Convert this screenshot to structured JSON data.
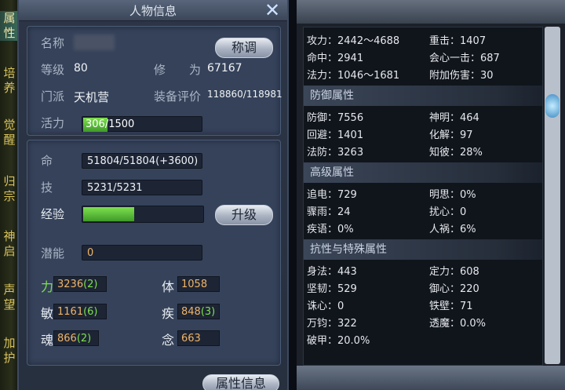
{
  "side_tabs": [
    "属性",
    "培养",
    "觉醒",
    "归宗",
    "神启",
    "声望",
    "加护"
  ],
  "panel": {
    "title": "人物信息",
    "name_label": "名称",
    "name_value": "...",
    "title_button": "称调",
    "level_label": "等级",
    "level_value": "80",
    "cultivation_label": "修　　为",
    "cultivation_value": "67167",
    "faction_label": "门派",
    "faction_value": "天机营",
    "gear_label": "装备评价",
    "gear_value": "118860/118981",
    "vitality_label": "活力",
    "vitality_current": "306",
    "vitality_text": "/1500",
    "vitality_fraction": 0.204
  },
  "stats": {
    "hp_label": "命",
    "hp_value": "51804/51804(+3600)",
    "skill_label": "技",
    "skill_value": "5231/5231",
    "exp_label": "经验",
    "exp_fraction": 0.43,
    "upgrade_button": "升级",
    "potential_label": "潜能",
    "potential_value": "0",
    "attrs": [
      {
        "label": "力",
        "value": "3236",
        "bonus": "(2)"
      },
      {
        "label": "体",
        "value": "1058",
        "bonus": ""
      },
      {
        "label": "敏",
        "value": "1161",
        "bonus": "(6)"
      },
      {
        "label": "疾",
        "value": "848",
        "bonus": "(3)"
      },
      {
        "label": "魂",
        "value": "866",
        "bonus": "(2)"
      },
      {
        "label": "念",
        "value": "663",
        "bonus": ""
      }
    ],
    "detail_button": "属性信息"
  },
  "right": {
    "basic": [
      [
        "攻力：2442～4688",
        "重击：1407"
      ],
      [
        "命中：2941",
        "会心一击：687"
      ],
      [
        "法力：1046～1681",
        "附加伤害：30"
      ]
    ],
    "defense_title": "防御属性",
    "defense": [
      [
        "防御：7556",
        "神明：464"
      ],
      [
        "回避：1401",
        "化解：97"
      ],
      [
        "法防：3263",
        "知彼：28%"
      ]
    ],
    "advanced_title": "高级属性",
    "advanced": [
      [
        "追电：729",
        "明思：0%"
      ],
      [
        "骤雨：24",
        "扰心：0"
      ],
      [
        "疾语：0%",
        "人祸：6%"
      ]
    ],
    "resist_title": "抗性与特殊属性",
    "resist": [
      [
        "身法：443",
        "定力：608"
      ],
      [
        "坚韧：529",
        "御心：220"
      ],
      [
        "诛心：0",
        "铁壁：71"
      ],
      [
        "万钧：322",
        "透魔：0.0%"
      ],
      [
        "破甲：20.0%",
        ""
      ]
    ]
  },
  "colors": {
    "accent_green": "#7ee04e",
    "attr_value": "#f0b468"
  }
}
